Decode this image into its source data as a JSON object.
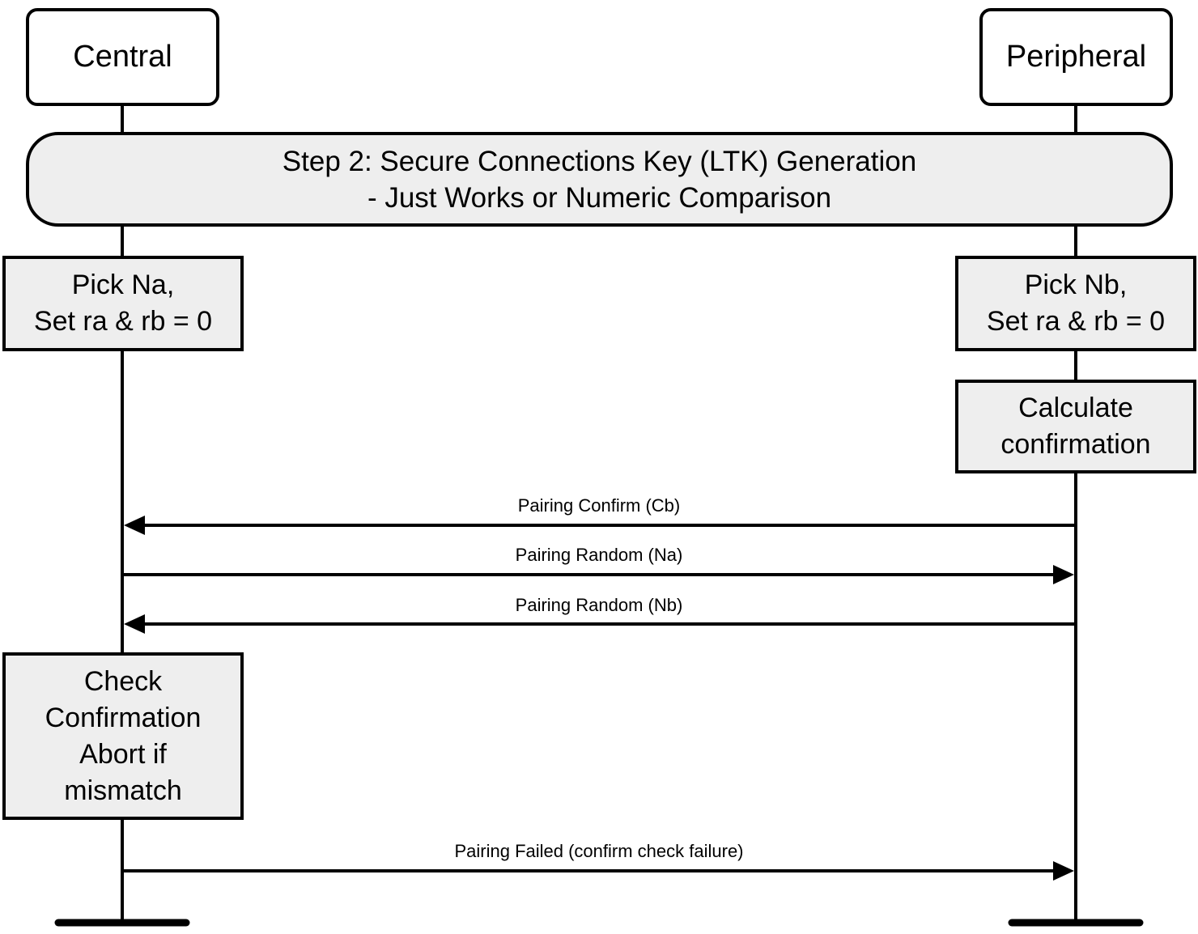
{
  "diagram": {
    "type": "sequence",
    "participants": [
      {
        "id": "central",
        "label": "Central"
      },
      {
        "id": "peripheral",
        "label": "Peripheral"
      }
    ],
    "banner": {
      "line1": "Step 2: Secure Connections Key (LTK) Generation",
      "line2": "- Just Works or Numeric Comparison"
    },
    "notes": {
      "central_pick": {
        "line1": "Pick Na,",
        "line2": "Set ra & rb = 0"
      },
      "peripheral_pick": {
        "line1": "Pick Nb,",
        "line2": "Set ra & rb = 0"
      },
      "peripheral_calc": {
        "line1": "Calculate",
        "line2": "confirmation"
      },
      "central_check": {
        "line1": "Check",
        "line2": "Confirmation",
        "line3": "Abort if",
        "line4": "mismatch"
      }
    },
    "messages": [
      {
        "label": "Pairing Confirm (Cb)",
        "from": "peripheral",
        "to": "central"
      },
      {
        "label": "Pairing Random (Na)",
        "from": "central",
        "to": "peripheral"
      },
      {
        "label": "Pairing Random (Nb)",
        "from": "peripheral",
        "to": "central"
      },
      {
        "label": "Pairing Failed (confirm check failure)",
        "from": "central",
        "to": "peripheral"
      }
    ]
  }
}
